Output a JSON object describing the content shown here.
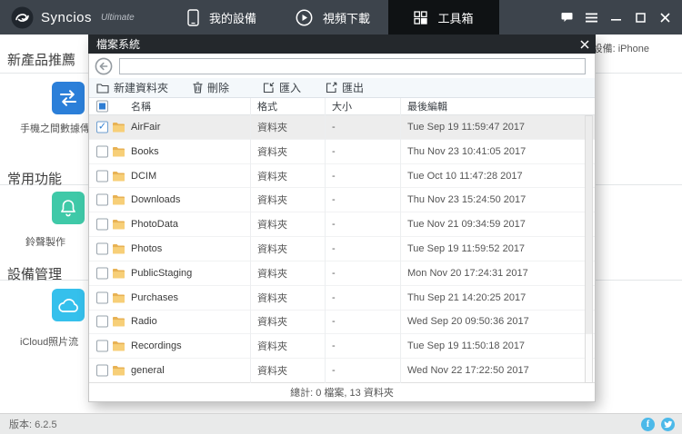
{
  "app": {
    "brand": "Syncios",
    "edition": "Ultimate"
  },
  "topbar": {
    "tabs": [
      {
        "label": "我的設備",
        "icon": "phone-icon"
      },
      {
        "label": "視頻下載",
        "icon": "play-icon"
      },
      {
        "label": "工具箱",
        "icon": "toolbox-grid-icon"
      }
    ],
    "active_tab": "工具箱",
    "window_icons": [
      "feedback-icon",
      "menu-icon",
      "minimize-icon",
      "maximize-icon",
      "close-icon"
    ]
  },
  "device": {
    "current_device_label": "當前設備: iPhone"
  },
  "sidebar": {
    "sections": [
      {
        "header": "新產品推薦",
        "items": [
          {
            "label": "手機之間數據傳",
            "icon": "transfer-arrows-icon",
            "color": "#2b7fd9"
          }
        ]
      },
      {
        "header": "常用功能",
        "items": [
          {
            "label": "鈴聲製作",
            "icon": "bell-icon",
            "color": "#3fc9a8"
          }
        ]
      },
      {
        "header": "設備管理",
        "items": [
          {
            "label": "iCloud照片流",
            "icon": "cloud-icon",
            "color": "#35c0ec"
          }
        ]
      }
    ]
  },
  "dialog": {
    "title": "檔案系統",
    "close_icon": "close-icon",
    "back_icon": "back-arrow-icon",
    "path_input": {
      "value": "",
      "placeholder": ""
    },
    "toolbar": [
      {
        "label": "新建資料夾",
        "icon": "new-folder-icon"
      },
      {
        "label": "刪除",
        "icon": "trash-icon"
      },
      {
        "label": "匯入",
        "icon": "import-icon"
      },
      {
        "label": "匯出",
        "icon": "export-icon"
      }
    ],
    "columns": [
      "名稱",
      "格式",
      "大小",
      "最後編輯"
    ],
    "rows": [
      {
        "name": "AirFair",
        "format": "資料夾",
        "size": "-",
        "edited": "Tue Sep 19 11:59:47 2017",
        "checked": true,
        "selected": true
      },
      {
        "name": "Books",
        "format": "資料夾",
        "size": "-",
        "edited": "Thu Nov 23 10:41:05 2017",
        "checked": false,
        "selected": false
      },
      {
        "name": "DCIM",
        "format": "資料夾",
        "size": "-",
        "edited": "Tue Oct 10 11:47:28 2017",
        "checked": false,
        "selected": false
      },
      {
        "name": "Downloads",
        "format": "資料夾",
        "size": "-",
        "edited": "Thu Nov 23 15:24:50 2017",
        "checked": false,
        "selected": false
      },
      {
        "name": "PhotoData",
        "format": "資料夾",
        "size": "-",
        "edited": "Tue Nov 21 09:34:59 2017",
        "checked": false,
        "selected": false
      },
      {
        "name": "Photos",
        "format": "資料夾",
        "size": "-",
        "edited": "Tue Sep 19 11:59:52 2017",
        "checked": false,
        "selected": false
      },
      {
        "name": "PublicStaging",
        "format": "資料夾",
        "size": "-",
        "edited": "Mon Nov 20 17:24:31 2017",
        "checked": false,
        "selected": false
      },
      {
        "name": "Purchases",
        "format": "資料夾",
        "size": "-",
        "edited": "Thu Sep 21 14:20:25 2017",
        "checked": false,
        "selected": false
      },
      {
        "name": "Radio",
        "format": "資料夾",
        "size": "-",
        "edited": "Wed Sep 20 09:50:36 2017",
        "checked": false,
        "selected": false
      },
      {
        "name": "Recordings",
        "format": "資料夾",
        "size": "-",
        "edited": "Tue Sep 19 11:50:18 2017",
        "checked": false,
        "selected": false
      },
      {
        "name": "general",
        "format": "資料夾",
        "size": "-",
        "edited": "Wed Nov 22 17:22:50 2017",
        "checked": false,
        "selected": false
      }
    ],
    "summary": "總計: 0 檔案, 13 資料夾"
  },
  "bottombar": {
    "version_label": "版本: 6.2.5",
    "social_icons": [
      "facebook-icon",
      "twitter-icon"
    ]
  },
  "colors": {
    "topbar": "#3d444c",
    "active_tab": "#0f1214",
    "dialog_titlebar": "#24282c",
    "accent_blue": "#2f7ed3",
    "selected_row": "#ededed",
    "social_blue": "#4cb9e9",
    "transfer_icon": "#2b7fd9",
    "bell_icon": "#3fc9a8",
    "cloud_icon": "#35c0ec",
    "folder_yellow": "#f7cf78"
  }
}
